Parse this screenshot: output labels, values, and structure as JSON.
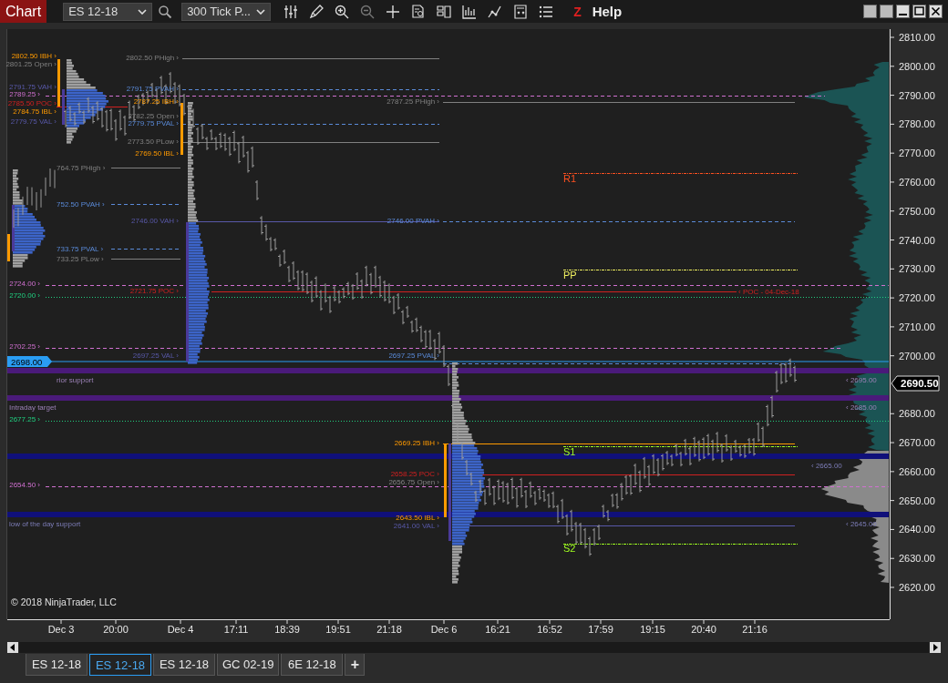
{
  "toolbar": {
    "chart_button": "Chart",
    "instrument": "ES 12-18",
    "bar_type": "300 Tick P...",
    "z_label": "Z",
    "help": "Help"
  },
  "chart": {
    "levels": [
      {
        "label": "2802.50 IBH ›",
        "kind": "ibh"
      },
      {
        "label": "2801.25 Open ›",
        "kind": "open"
      },
      {
        "label": "2791.75 VAH ›",
        "kind": "vah"
      },
      {
        "label": "2789.25 ›",
        "kind": "marker"
      },
      {
        "label": "2785.50 POC ›",
        "kind": "poc"
      },
      {
        "label": "2784.75 IBL ›",
        "kind": "ibl"
      },
      {
        "label": "2779.75 VAL ›",
        "kind": "val"
      },
      {
        "label": "764.75 PHigh ›",
        "kind": "phigh"
      },
      {
        "label": "752.50 PVAH ›",
        "kind": "pvah"
      },
      {
        "label": "733.75 PVAL ›",
        "kind": "pval"
      },
      {
        "label": "733.25 PLow ›",
        "kind": "plow"
      },
      {
        "label": "2724.00 ›",
        "kind": "marker"
      },
      {
        "label": "2720.00 ›",
        "kind": "reference"
      },
      {
        "label": "2702.25 ›",
        "kind": "marker"
      },
      {
        "label": "rior support",
        "kind": "zone"
      },
      {
        "label": "Intraday target",
        "kind": "zone"
      },
      {
        "label": "2677.25 ›",
        "kind": "reference"
      },
      {
        "label": "2654.50 ›",
        "kind": "marker"
      },
      {
        "label": "low of the day support",
        "kind": "deep_zone"
      },
      {
        "label": "2802.50 PHigh ›",
        "kind": "phigh"
      },
      {
        "label": "2791.75 PVAH ›",
        "kind": "pvah"
      },
      {
        "label": "2787.25 IBH ›",
        "kind": "ibh"
      },
      {
        "label": "2782.25 Open ›",
        "kind": "open"
      },
      {
        "label": "2779.75 PVAL ›",
        "kind": "pval"
      },
      {
        "label": "2773.50 PLow ›",
        "kind": "plow"
      },
      {
        "label": "2769.50 IBL ›",
        "kind": "ibl"
      },
      {
        "label": "2746.00 VAH ›",
        "kind": "vah"
      },
      {
        "label": "2721.75 POC ›",
        "kind": "poc"
      },
      {
        "label": "2697.25 VAL ›",
        "kind": "val"
      },
      {
        "label": "2787.25 PHigh ›",
        "kind": "phigh"
      },
      {
        "label": "2746.00 PVAH ›",
        "kind": "pvah"
      },
      {
        "label": "2697.25 PVAL ›",
        "kind": "pval"
      },
      {
        "label": "2669.25 IBH ›",
        "kind": "ibh"
      },
      {
        "label": "2658.25 POC ›",
        "kind": "poc"
      },
      {
        "label": "2656.75 Open ›",
        "kind": "open"
      },
      {
        "label": "2643.50 IBL ›",
        "kind": "ibl"
      },
      {
        "label": "2641.00 VAL ›",
        "kind": "val"
      },
      {
        "label": "‹ POC - 04-Dec-18",
        "kind": "poc"
      },
      {
        "label": "R1",
        "kind": "resistance"
      },
      {
        "label": "PP",
        "kind": "pivot"
      },
      {
        "label": "S1",
        "kind": "support"
      },
      {
        "label": "S2",
        "kind": "support"
      },
      {
        "label": "‹ 2695.00",
        "kind": "zone"
      },
      {
        "label": "‹ 2685.00",
        "kind": "zone"
      },
      {
        "label": "‹ 2665.00",
        "kind": "deep_zone"
      },
      {
        "label": "‹ 2645.00",
        "kind": "deep_zone"
      }
    ],
    "current_price": "2698.00",
    "last_price": "2690.50",
    "copyright": "© 2018 NinjaTrader, LLC",
    "y_ticks": [
      "2810.00",
      "2800.00",
      "2790.00",
      "2780.00",
      "2770.00",
      "2760.00",
      "2750.00",
      "2740.00",
      "2730.00",
      "2720.00",
      "2710.00",
      "2700.00",
      "2680.00",
      "2670.00",
      "2660.00",
      "2650.00",
      "2640.00",
      "2630.00",
      "2620.00"
    ],
    "x_ticks": [
      "Dec 3",
      "20:00",
      "Dec 4",
      "17:11",
      "18:39",
      "19:51",
      "21:18",
      "Dec 6",
      "16:21",
      "16:52",
      "17:59",
      "19:15",
      "20:40",
      "21:16"
    ]
  },
  "tabs": [
    {
      "label": "ES 12-18",
      "selected": false
    },
    {
      "label": "ES 12-18",
      "selected": true
    },
    {
      "label": "ES 12-18",
      "selected": false
    },
    {
      "label": "GC 02-19",
      "selected": false
    },
    {
      "label": "6E 12-18",
      "selected": false
    }
  ],
  "add_tab": "+"
}
